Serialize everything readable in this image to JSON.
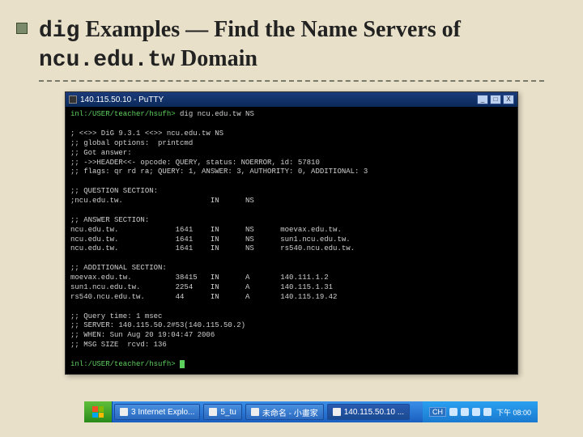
{
  "title": {
    "part1": "dig",
    "part2": " Examples —  Find the Name Servers of ",
    "part3": "ncu.edu.tw",
    "part4": " Domain"
  },
  "window": {
    "title": "140.115.50.10 - PuTTY",
    "btn_min": "_",
    "btn_max": "□",
    "btn_close": "X"
  },
  "term": {
    "prompt1": "inl:/USER/teacher/hsufh> ",
    "cmd1": "dig ncu.edu.tw NS",
    "l01": "",
    "l02": "; <<>> DiG 9.3.1 <<>> ncu.edu.tw NS",
    "l03": ";; global options:  printcmd",
    "l04": ";; Got answer:",
    "l05": ";; ->>HEADER<<- opcode: QUERY, status: NOERROR, id: 57810",
    "l06": ";; flags: qr rd ra; QUERY: 1, ANSWER: 3, AUTHORITY: 0, ADDITIONAL: 3",
    "l07": "",
    "l08": ";; QUESTION SECTION:",
    "l09": ";ncu.edu.tw.                    IN      NS",
    "l10": "",
    "l11": ";; ANSWER SECTION:",
    "l12": "ncu.edu.tw.             1641    IN      NS      moevax.edu.tw.",
    "l13": "ncu.edu.tw.             1641    IN      NS      sun1.ncu.edu.tw.",
    "l14": "ncu.edu.tw.             1641    IN      NS      rs540.ncu.edu.tw.",
    "l15": "",
    "l16": ";; ADDITIONAL SECTION:",
    "l17": "moevax.edu.tw.          38415   IN      A       140.111.1.2",
    "l18": "sun1.ncu.edu.tw.        2254    IN      A       140.115.1.31",
    "l19": "rs540.ncu.edu.tw.       44      IN      A       140.115.19.42",
    "l20": "",
    "l21": ";; Query time: 1 msec",
    "l22": ";; SERVER: 140.115.50.2#53(140.115.50.2)",
    "l23": ";; WHEN: Sun Aug 20 19:04:47 2006",
    "l24": ";; MSG SIZE  rcvd: 136",
    "l25": "",
    "prompt2": "inl:/USER/teacher/hsufh> "
  },
  "taskbar": {
    "items": [
      {
        "label": "3 Internet Explo..."
      },
      {
        "label": "5_tu"
      },
      {
        "label": "未命名 - 小畫家"
      },
      {
        "label": "140.115.50.10 ..."
      }
    ],
    "lang": "CH",
    "clock": "下午 08:00"
  }
}
